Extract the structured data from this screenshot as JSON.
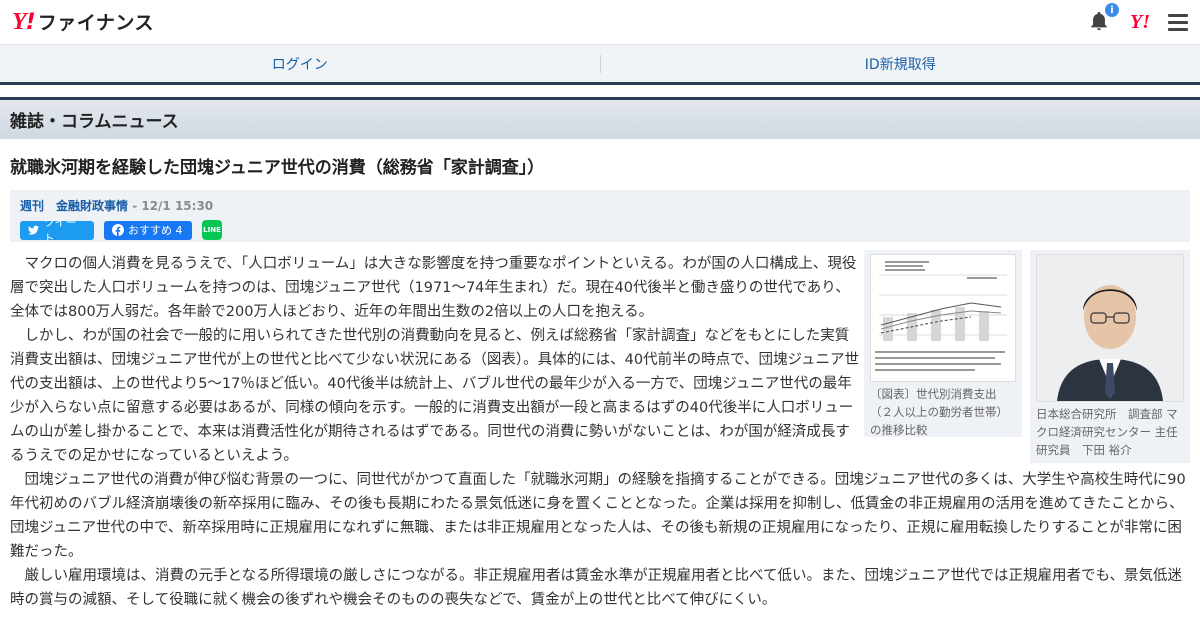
{
  "header": {
    "logo_y": "Y",
    "logo_ex": "!",
    "logo_name": "ファイナンス",
    "notification_badge": "i",
    "yahoo_icon": "Y!"
  },
  "loginbar": {
    "login": "ログイン",
    "signup": "ID新規取得"
  },
  "section_title": "雑誌・コラムニュース",
  "article": {
    "title": "就職氷河期を経験した団塊ジュニア世代の消費（総務省「家計調査」）",
    "source": "週刊　金融財政事情",
    "date": " - 12/1 15:30",
    "tweet_label": "ツイート",
    "recommend_label": "おすすめ 4",
    "line_label": "LINE",
    "figure_caption": "〔図表〕世代別消費支出（２人以上の勤労者世帯）の推移比較",
    "author_caption": "日本総合研究所　調査部 マクロ経済研究センター 主任研究員　下田 裕介",
    "paragraphs": [
      "マクロの個人消費を見るうえで、「人口ボリューム」は大きな影響度を持つ重要なポイントといえる。わが国の人口構成上、現役層で突出した人口ボリュームを持つのは、団塊ジュニア世代（1971～74年生まれ）だ。現在40代後半と働き盛りの世代であり、全体では800万人弱だ。各年齢で200万人ほどおり、近年の年間出生数の2倍以上の人口を抱える。",
      "しかし、わが国の社会で一般的に用いられてきた世代別の消費動向を見ると、例えば総務省「家計調査」などをもとにした実質消費支出額は、団塊ジュニア世代が上の世代と比べて少ない状況にある（図表）。具体的には、40代前半の時点で、団塊ジュニア世代の支出額は、上の世代より5～17％ほど低い。40代後半は統計上、バブル世代の最年少が入る一方で、団塊ジュニア世代の最年少が入らない点に留意する必要はあるが、同様の傾向を示す。一般的に消費支出額が一段と高まるはずの40代後半に人口ボリュームの山が差し掛かることで、本来は消費活性化が期待されるはずである。同世代の消費に勢いがないことは、わが国が経済成長するうえでの足かせになっているといえよう。",
      "団塊ジュニア世代の消費が伸び悩む背景の一つに、同世代がかつて直面した「就職氷河期」の経験を指摘することができる。団塊ジュニア世代の多くは、大学生や高校生時代に90年代初めのバブル経済崩壊後の新卒採用に臨み、その後も長期にわたる景気低迷に身を置くこととなった。企業は採用を抑制し、低賃金の非正規雇用の活用を進めてきたことから、団塊ジュニア世代の中で、新卒採用時に正規雇用になれずに無職、または非正規雇用となった人は、その後も新規の正規雇用になったり、正規に雇用転換したりすることが非常に困難だった。",
      "厳しい雇用環境は、消費の元手となる所得環境の厳しさにつながる。非正規雇用者は賃金水準が正規雇用者と比べて低い。また、団塊ジュニア世代では正規雇用者でも、景気低迷時の賞与の減額、そして役職に就く機会の後ずれや機会そのものの喪失などで、賃金が上の世代と比べて伸びにくい。"
    ]
  }
}
